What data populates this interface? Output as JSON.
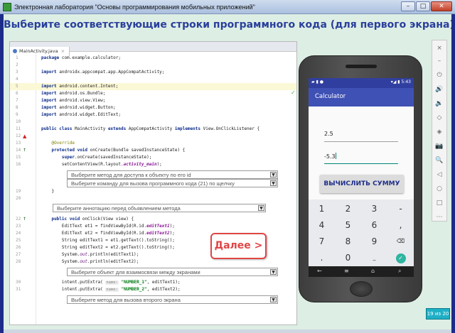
{
  "window": {
    "title": "Электронная лаборатория \"Основы программирования мобильных приложений\"",
    "controls": [
      "–",
      "□",
      "✕"
    ]
  },
  "heading": "Выберите соответствующие строки программного кода (для первого экрана)",
  "editor": {
    "file_tab": "MainActivity.java",
    "lines": [
      {
        "n": "1",
        "html": "<span class=\"kw\">package</span> com.example.calculator;"
      },
      {
        "n": "2",
        "html": ""
      },
      {
        "n": "3",
        "html": "<span class=\"kw\">import</span> androidx.appcompat.app.AppCompatActivity;"
      },
      {
        "n": "4",
        "html": ""
      },
      {
        "n": "5",
        "html": "<span class=\"kw\">import</span> android.content.Intent;",
        "hl": true
      },
      {
        "n": "6",
        "html": "<span class=\"kw\">import</span> android.os.Bundle;"
      },
      {
        "n": "7",
        "html": "<span class=\"kw\">import</span> android.view.View;"
      },
      {
        "n": "8",
        "html": "<span class=\"kw\">import</span> android.widget.Button;"
      },
      {
        "n": "9",
        "html": "<span class=\"kw\">import</span> android.widget.EditText;"
      },
      {
        "n": "10",
        "html": ""
      },
      {
        "n": "11",
        "html": "<span class=\"kw\">public class</span> MainActivity <span class=\"kw\">extends</span> AppCompatActivity <span class=\"kw\">implements</span> View.OnClickListener {"
      },
      {
        "n": "12",
        "html": ""
      },
      {
        "n": "13",
        "html": "    <span class=\"an\">@Override</span>"
      },
      {
        "n": "14",
        "html": "    <span class=\"kw\">protected void</span> onCreate(Bundle savedInstanceState) {"
      },
      {
        "n": "15",
        "html": "        <span class=\"kw\">super</span>.onCreate(savedInstanceState);"
      },
      {
        "n": "16",
        "html": "        setContentView(R.layout.<span class=\"pf\">activity_main</span>);"
      },
      {
        "n": "19",
        "html": "    }"
      },
      {
        "n": "20",
        "html": ""
      },
      {
        "n": "22",
        "html": "    <span class=\"kw\">public void</span> onClick(View view) {"
      },
      {
        "n": "23",
        "html": "        EditText et1 = findViewById(R.id.<span class=\"pf\">editText1</span>);"
      },
      {
        "n": "24",
        "html": "        EditText et2 = findViewById(R.id.<span class=\"pf\">editText2</span>);"
      },
      {
        "n": "25",
        "html": "        String editText1 = et1.getText().toString();"
      },
      {
        "n": "26",
        "html": "        String editText2 = et2.getText().toString();"
      },
      {
        "n": "27",
        "html": "        System.<span class=\"sf\">out</span>.println(editText1);"
      },
      {
        "n": "28",
        "html": "        System.<span class=\"sf\">out</span>.println(editText2);"
      },
      {
        "n": "30",
        "html": "        intent.putExtra( <span class=\"hint\">name:</span> <span class=\"st\">\"NUMBER_1\"</span>, editText1);"
      },
      {
        "n": "31",
        "html": "        intent.putExtra( <span class=\"hint\">name:</span> <span class=\"st\">\"NUMBER_2\"</span>, editText2);"
      }
    ],
    "dropdowns": [
      "Выберите метод для доступа к объекту по его id",
      "Выберите команду для вызова программного кода (21) по щелчку",
      "Выберите аннотацию перед объявлением метода",
      "Выберите объект для взаимосвязи между экранами",
      "Выберите метод для вызова второго экрана"
    ],
    "dropdown_arrow": "▼",
    "check": "✓"
  },
  "next_button": "Далее >",
  "phone": {
    "status_time": "5:43",
    "status_icons_left": "▰ ▮ ●",
    "status_icons_right": "▾◢ ▮",
    "app_title": "Calculator",
    "field1": "2.5",
    "field2": "-5.3",
    "sum_button": "ВЫЧИСЛИТЬ СУММУ",
    "keys": [
      "1",
      "2",
      "3",
      "-",
      "4",
      "5",
      "6",
      ",",
      "7",
      "8",
      "9",
      "⌫",
      ".",
      "0",
      "_",
      "✓"
    ],
    "nav": [
      "←",
      "≡",
      "⌂",
      "⌕"
    ]
  },
  "toolbar_icons": [
    "×",
    "–",
    "⏻",
    "🔊",
    "🔉",
    "◇",
    "◈",
    "📷",
    "🔍",
    "◁",
    "○",
    "□",
    "⋯"
  ],
  "page_counter": "19 из 20"
}
